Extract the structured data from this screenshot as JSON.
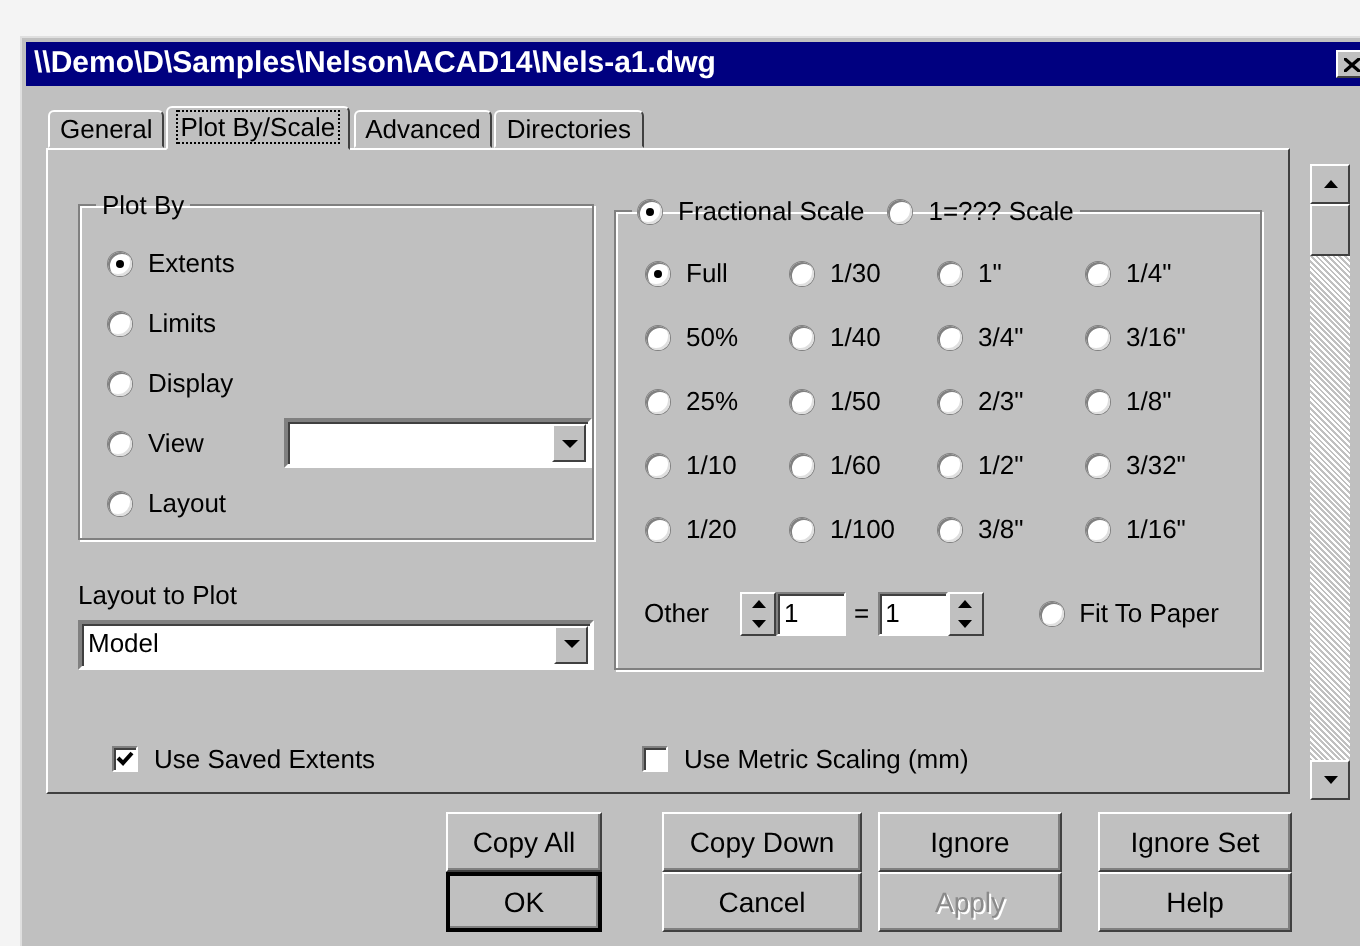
{
  "window": {
    "title": "\\\\Demo\\D\\Samples\\Nelson\\ACAD14\\Nels-a1.dwg"
  },
  "tabs": [
    {
      "label": "General",
      "selected": false
    },
    {
      "label": "Plot By/Scale",
      "selected": true
    },
    {
      "label": "Advanced",
      "selected": false
    },
    {
      "label": "Directories",
      "selected": false
    }
  ],
  "plot_by": {
    "title": "Plot By",
    "options": [
      {
        "label": "Extents",
        "selected": true,
        "kind": "plain"
      },
      {
        "label": "Limits",
        "selected": false,
        "kind": "plain"
      },
      {
        "label": "Display",
        "selected": false,
        "kind": "plain"
      },
      {
        "label": "View",
        "selected": false,
        "kind": "with-dropdown"
      },
      {
        "label": "Layout",
        "selected": false,
        "kind": "plain"
      }
    ]
  },
  "layout_to_plot": {
    "label": "Layout to Plot",
    "value": "Model"
  },
  "use_saved_extents": {
    "label": "Use Saved Extents",
    "checked": true
  },
  "scale": {
    "modes": [
      {
        "label": "Fractional Scale",
        "selected": true
      },
      {
        "label": "1=??? Scale",
        "selected": false
      }
    ],
    "options": [
      {
        "label": "Full",
        "selected": true
      },
      {
        "label": "1/30",
        "selected": false
      },
      {
        "label": "1\"",
        "selected": false
      },
      {
        "label": "1/4\"",
        "selected": false
      },
      {
        "label": "50%",
        "selected": false
      },
      {
        "label": "1/40",
        "selected": false
      },
      {
        "label": "3/4\"",
        "selected": false
      },
      {
        "label": "3/16\"",
        "selected": false
      },
      {
        "label": "25%",
        "selected": false
      },
      {
        "label": "1/50",
        "selected": false
      },
      {
        "label": "2/3\"",
        "selected": false
      },
      {
        "label": "1/8\"",
        "selected": false
      },
      {
        "label": "1/10",
        "selected": false
      },
      {
        "label": "1/60",
        "selected": false
      },
      {
        "label": "1/2\"",
        "selected": false
      },
      {
        "label": "3/32\"",
        "selected": false
      },
      {
        "label": "1/20",
        "selected": false
      },
      {
        "label": "1/100",
        "selected": false
      },
      {
        "label": "3/8\"",
        "selected": false
      },
      {
        "label": "1/16\"",
        "selected": false
      }
    ],
    "other": {
      "label": "Other",
      "left_value": "1",
      "equals": "=",
      "right_value": "1"
    },
    "fit_to_paper": {
      "label": "Fit To Paper",
      "selected": false
    }
  },
  "use_metric_scaling": {
    "label": "Use Metric Scaling (mm)",
    "checked": false
  },
  "buttons": [
    {
      "label": "Copy All",
      "default": false,
      "disabled": false
    },
    {
      "label": "Copy Down",
      "default": false,
      "disabled": false
    },
    {
      "label": "Ignore",
      "default": false,
      "disabled": false
    },
    {
      "label": "Ignore Set",
      "default": false,
      "disabled": false
    },
    {
      "label": "OK",
      "default": true,
      "disabled": false
    },
    {
      "label": "Cancel",
      "default": false,
      "disabled": false
    },
    {
      "label": "Apply",
      "default": false,
      "disabled": true
    },
    {
      "label": "Help",
      "default": false,
      "disabled": false
    }
  ]
}
